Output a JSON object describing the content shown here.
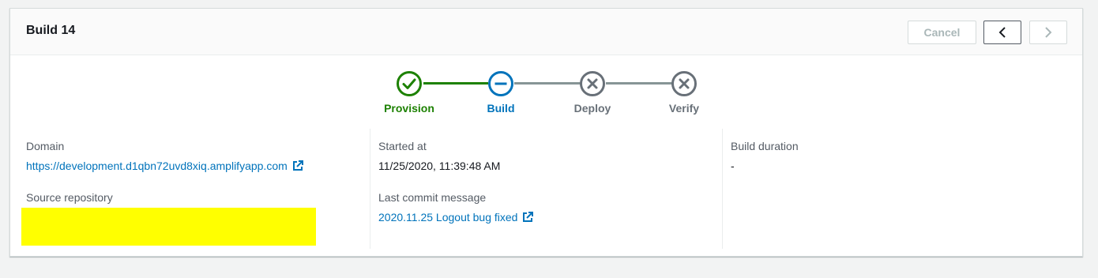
{
  "header": {
    "title": "Build 14",
    "cancel_label": "Cancel",
    "prev_icon": "chevron-left-icon",
    "next_icon": "chevron-right-icon"
  },
  "stepper": {
    "steps": [
      {
        "label": "Provision",
        "status": "success",
        "icon": "check-circle-icon",
        "color": "#1d8102"
      },
      {
        "label": "Build",
        "status": "in-progress",
        "icon": "minus-circle-icon",
        "color": "#0073bb"
      },
      {
        "label": "Deploy",
        "status": "pending",
        "icon": "x-circle-icon",
        "color": "#687078"
      },
      {
        "label": "Verify",
        "status": "pending",
        "icon": "x-circle-icon",
        "color": "#687078"
      }
    ]
  },
  "details": {
    "domain_label": "Domain",
    "domain_value": "https://development.d1qbn72uvd8xiq.amplifyapp.com",
    "source_repo_label": "Source repository",
    "started_label": "Started at",
    "started_value": "11/25/2020, 11:39:48 AM",
    "commit_label": "Last commit message",
    "commit_value": "2020.11.25 Logout bug fixed",
    "duration_label": "Build duration",
    "duration_value": "-"
  },
  "colors": {
    "link": "#0073bb",
    "success": "#1d8102",
    "in_progress": "#0073bb",
    "pending": "#687078",
    "redaction": "#ffff00"
  }
}
